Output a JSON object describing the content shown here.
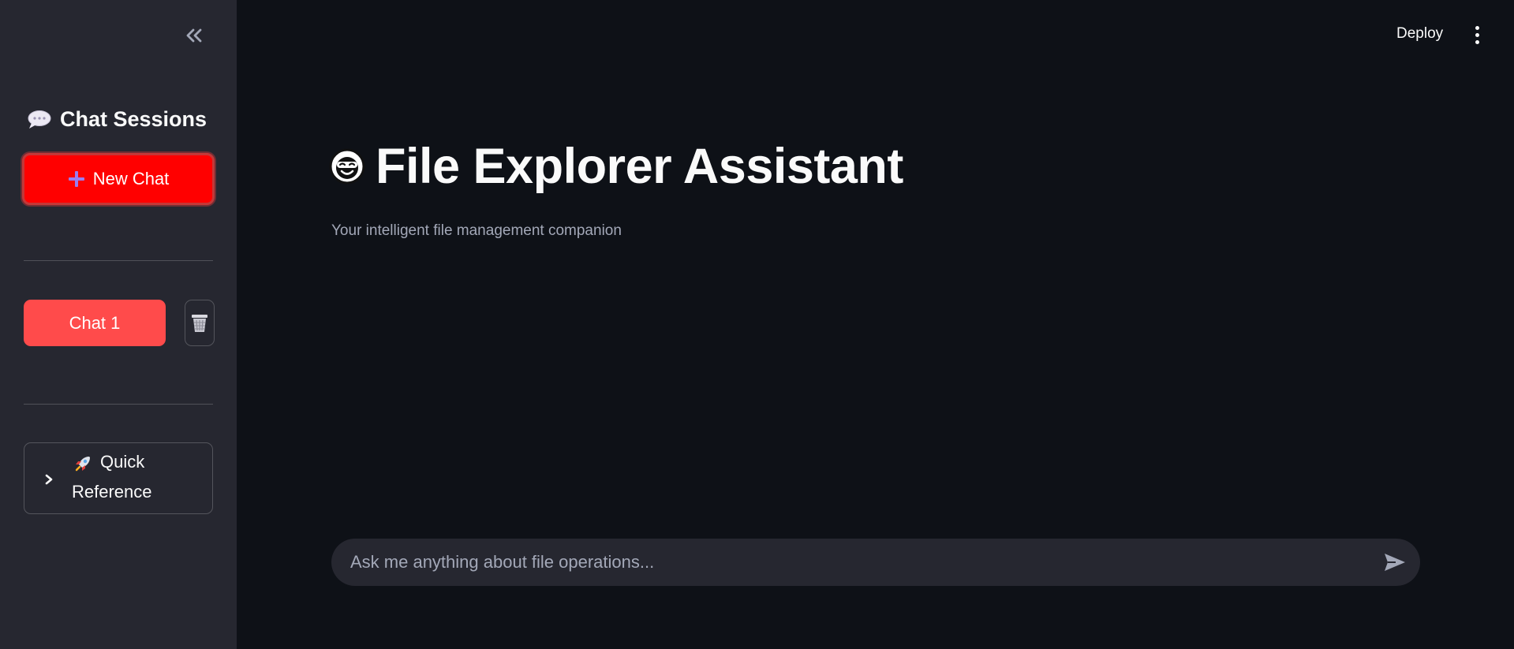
{
  "sidebar": {
    "collapse_icon": "double-chevron-left-icon",
    "title": "Chat Sessions",
    "title_icon": "speech-bubble-icon",
    "new_chat": {
      "label": "New Chat",
      "icon": "plus-icon",
      "color": "#ff0000"
    },
    "chats": [
      {
        "label": "Chat 1",
        "delete_icon": "wastebasket-icon",
        "color": "#ff4b4b"
      }
    ],
    "expander": {
      "icon": "rocket-icon",
      "label_line1": "Quick",
      "label_line2": "Reference",
      "expanded": false
    }
  },
  "header": {
    "deploy_label": "Deploy",
    "menu_icon": "vertical-ellipsis-icon"
  },
  "main": {
    "title": "File Explorer Assistant",
    "title_icon": "smiling-face-icon",
    "subtitle": "Your intelligent file management companion"
  },
  "chat_input": {
    "placeholder": "Ask me anything about file operations...",
    "value": "",
    "send_icon": "send-arrow-icon"
  },
  "colors": {
    "background": "#0e1117",
    "sidebar": "#262730",
    "accent": "#ff4b4b",
    "text": "#fafafa",
    "muted_text": "#a3a8b8"
  }
}
